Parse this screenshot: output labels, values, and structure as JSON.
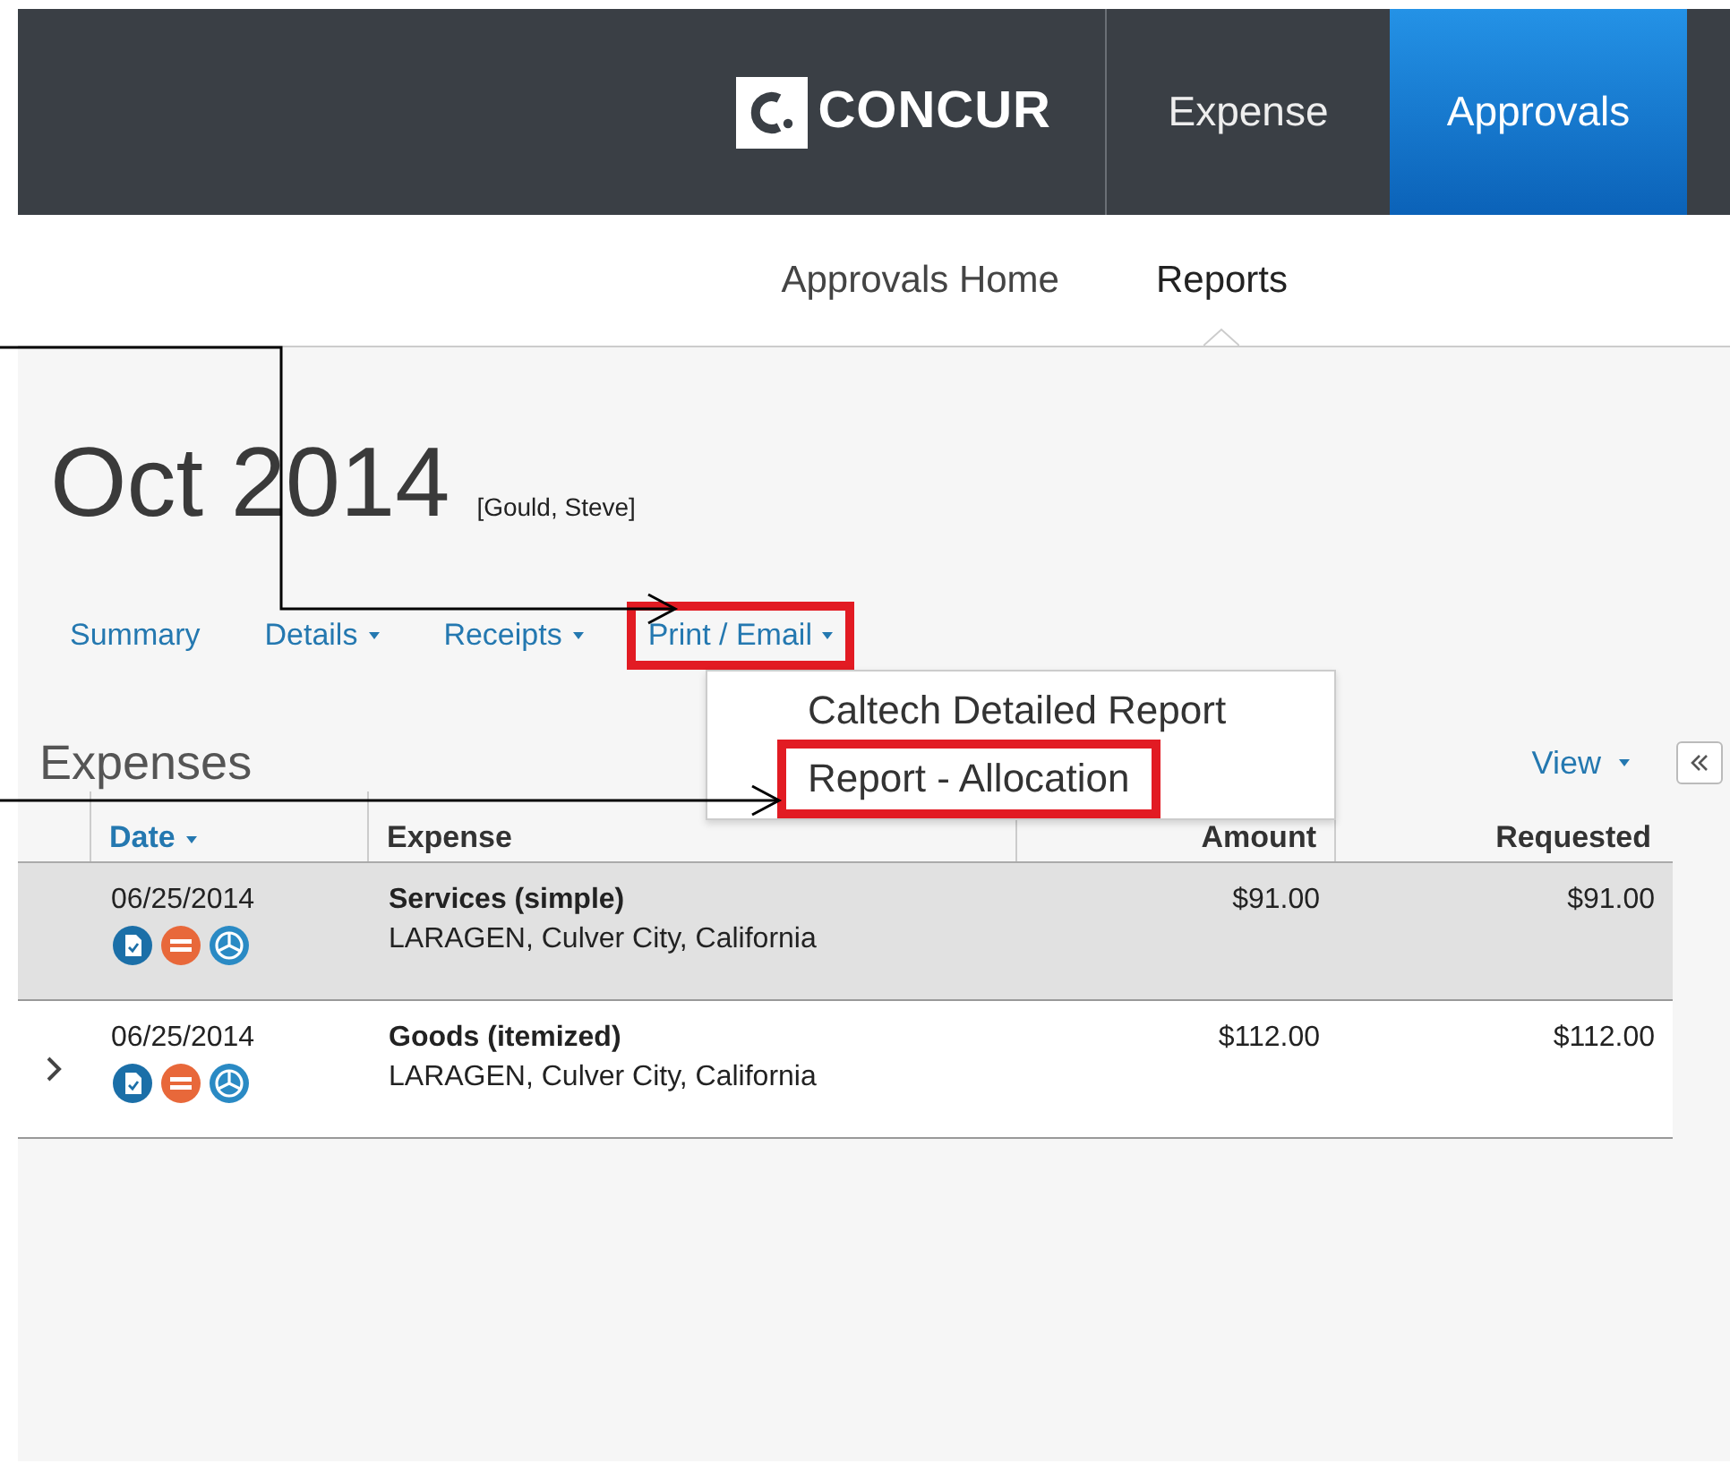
{
  "top_bar": {
    "logo": "CONCUR",
    "tabs": [
      {
        "label": "Expense",
        "selected": false
      },
      {
        "label": "Approvals",
        "selected": true
      }
    ]
  },
  "sub_nav": [
    {
      "label": "Approvals Home",
      "selected": false
    },
    {
      "label": "Reports",
      "selected": true
    }
  ],
  "report": {
    "title": "Oct 2014",
    "owner": "[Gould, Steve]"
  },
  "report_tabs": [
    {
      "label": "Summary",
      "dropdown": false,
      "annotated": false
    },
    {
      "label": "Details",
      "dropdown": true,
      "annotated": false
    },
    {
      "label": "Receipts",
      "dropdown": true,
      "annotated": false
    },
    {
      "label": "Print / Email",
      "dropdown": true,
      "annotated": true
    }
  ],
  "print_menu": [
    {
      "label": "Caltech Detailed Report",
      "annotated": false
    },
    {
      "label": "Report - Allocation",
      "annotated": true
    }
  ],
  "expenses": {
    "heading": "Expenses",
    "view": "View",
    "columns": [
      {
        "label": "Date",
        "sorted": true
      },
      {
        "label": "Expense",
        "sorted": false
      },
      {
        "label": "Amount",
        "sorted": false
      },
      {
        "label": "Requested",
        "sorted": false
      }
    ],
    "rows": [
      {
        "date": "06/25/2014",
        "type": "Services (simple)",
        "vendor": "LARAGEN, Culver City, California",
        "amount": "$91.00",
        "requested": "$91.00",
        "selected": true,
        "expandable": false
      },
      {
        "date": "06/25/2014",
        "type": "Goods (itemized)",
        "vendor": "LARAGEN, Culver City, California",
        "amount": "$112.00",
        "requested": "$112.00",
        "selected": false,
        "expandable": true
      }
    ]
  }
}
